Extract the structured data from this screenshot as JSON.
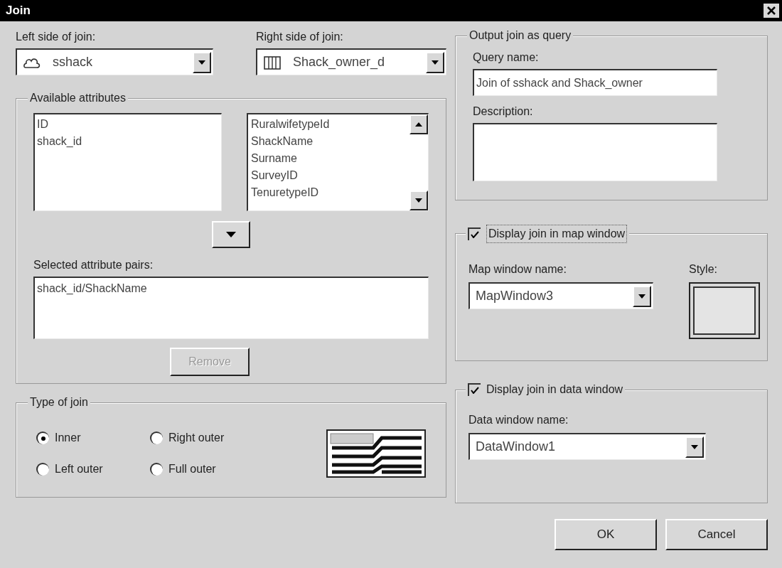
{
  "window": {
    "title": "Join"
  },
  "left_side": {
    "label": "Left side of join:",
    "value": "sshack"
  },
  "right_side": {
    "label": "Right side of join:",
    "value": "Shack_owner_d"
  },
  "available_attributes": {
    "title": "Available attributes",
    "left_items": [
      "ID",
      "shack_id"
    ],
    "right_items": [
      "RuralwifetypeId",
      "ShackName",
      "Surname",
      "SurveyID",
      "TenuretypeID"
    ]
  },
  "selected_pairs": {
    "label": "Selected attribute pairs:",
    "items": [
      "shack_id/ShackName"
    ]
  },
  "remove_button": {
    "label": "Remove",
    "disabled": true
  },
  "join_type": {
    "title": "Type of join",
    "options": [
      {
        "label": "Inner",
        "selected": true
      },
      {
        "label": "Right outer",
        "selected": false
      },
      {
        "label": "Left outer",
        "selected": false
      },
      {
        "label": "Full outer",
        "selected": false
      }
    ]
  },
  "output_query": {
    "title": "Output join as query",
    "query_name_label": "Query name:",
    "query_name": "Join of sshack and Shack_owner",
    "description_label": "Description:"
  },
  "map_window": {
    "label": "Display join in map window",
    "checked": true,
    "name_label": "Map window name:",
    "name": "MapWindow3",
    "style_label": "Style:"
  },
  "data_window": {
    "label": "Display join in data window",
    "checked": true,
    "name_label": "Data window name:",
    "name": "DataWindow1"
  },
  "buttons": [
    "OK",
    "Cancel"
  ]
}
